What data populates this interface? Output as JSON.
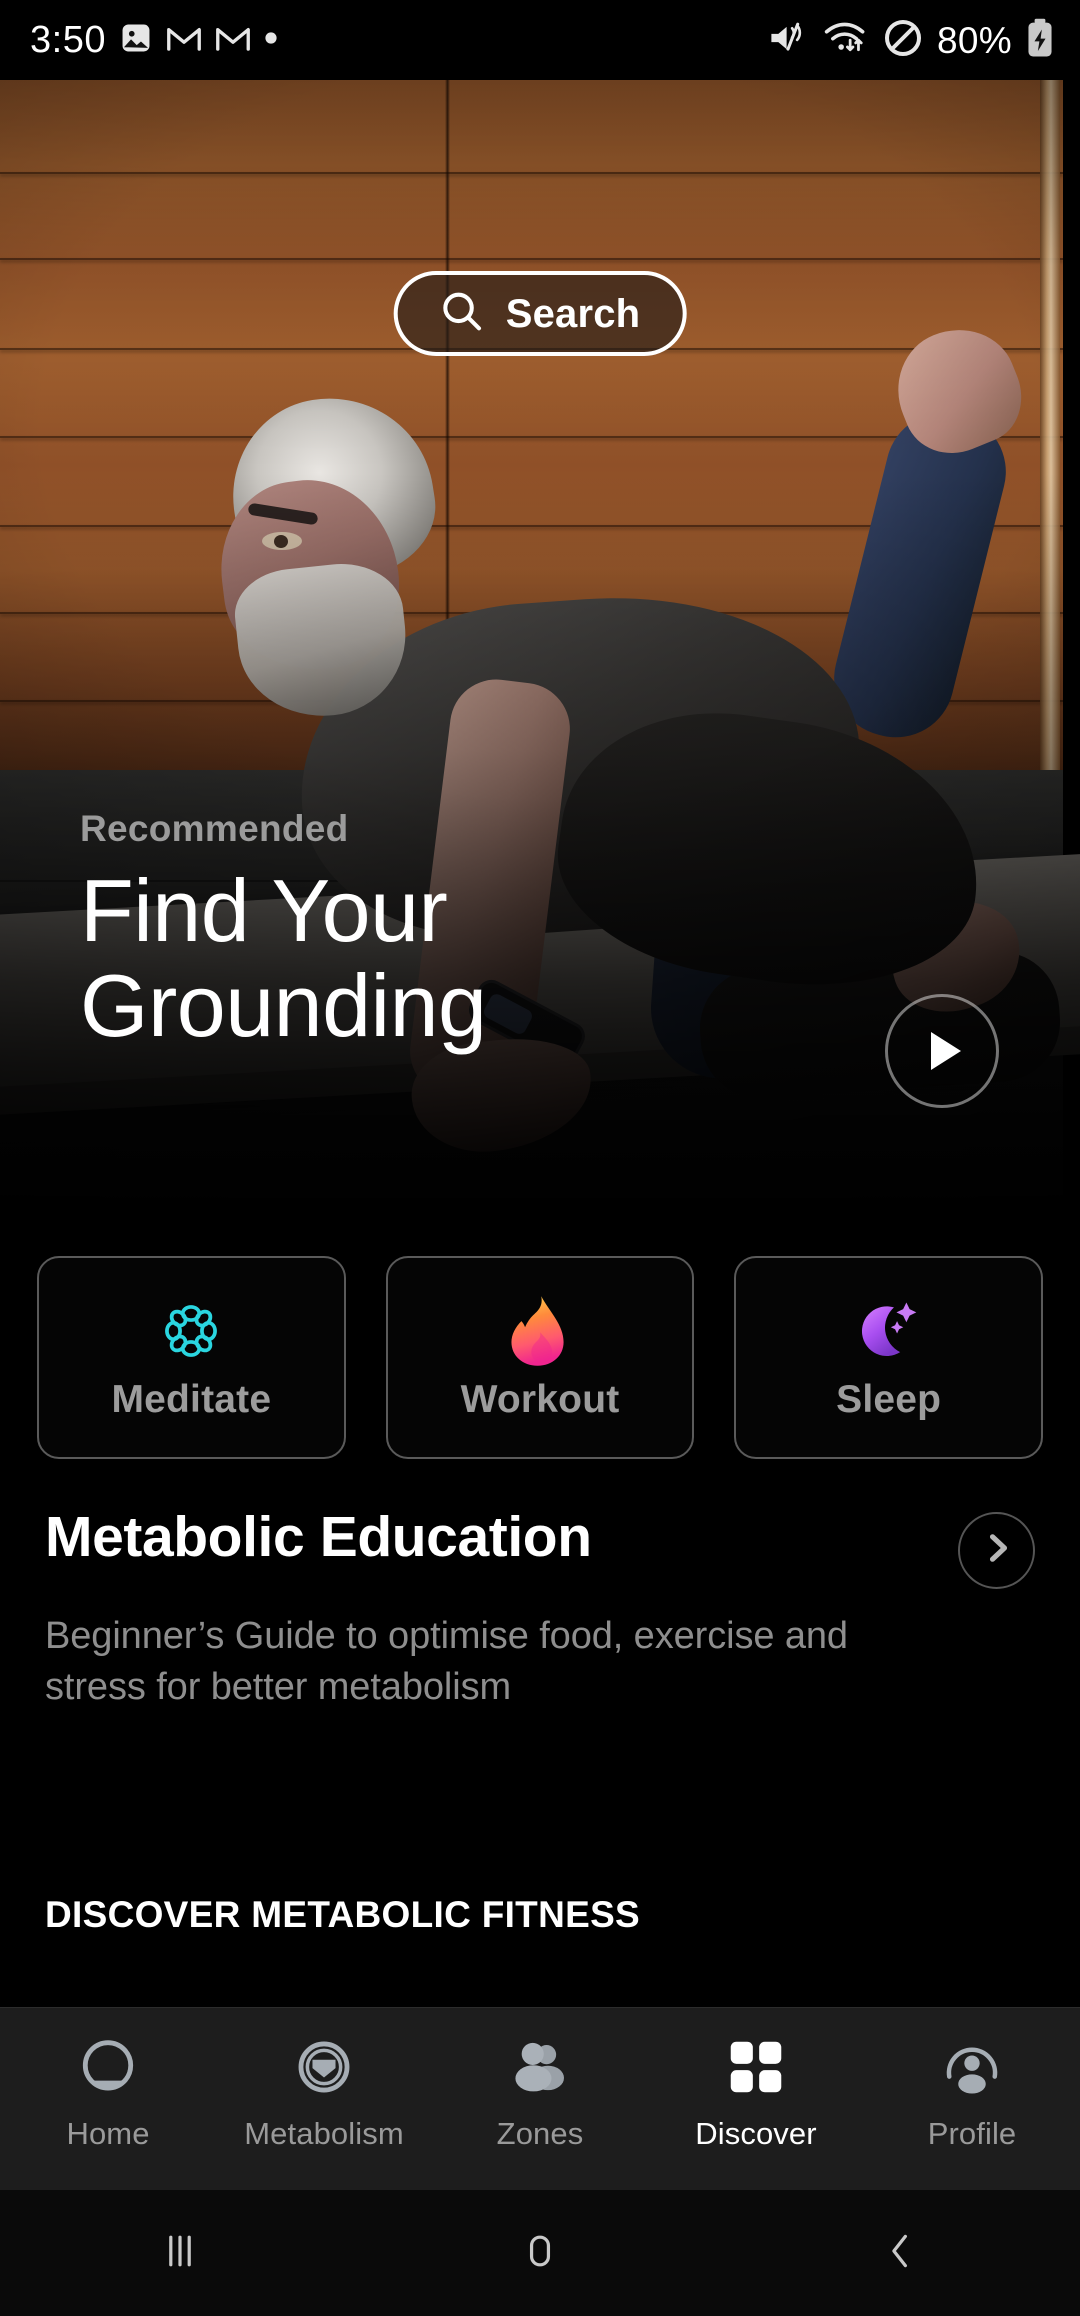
{
  "status_bar": {
    "time": "3:50",
    "left_icons": [
      "photo-icon",
      "gmail-icon",
      "gmail-icon",
      "dot-icon"
    ],
    "right_icons": [
      "mute-icon",
      "wifi-icon",
      "do-not-disturb-icon"
    ],
    "battery_percent": "80%",
    "battery_icon": "battery-charging-icon"
  },
  "hero": {
    "search_label": "Search",
    "search_icon": "search-icon",
    "kicker": "Recommended",
    "title_line1": "Find Your",
    "title_line2": "Grounding",
    "play_icon": "play-icon"
  },
  "categories": [
    {
      "label": "Meditate",
      "icon": "lotus-icon",
      "color": "#2ad6e0"
    },
    {
      "label": "Workout",
      "icon": "flame-icon",
      "color": "#ff7a3d"
    },
    {
      "label": "Sleep",
      "icon": "moon-icon",
      "color": "#b05cf0"
    }
  ],
  "education": {
    "title": "Metabolic Education",
    "subtitle": "Beginner’s Guide to optimise food, exercise and stress for better metabolism",
    "chevron_icon": "chevron-right-icon"
  },
  "discover": {
    "section_header": "DISCOVER METABOLIC FITNESS"
  },
  "bottom_nav": {
    "active": "Discover",
    "items": [
      {
        "label": "Home",
        "icon": "home-circle-icon"
      },
      {
        "label": "Metabolism",
        "icon": "metabolism-gauge-icon"
      },
      {
        "label": "Zones",
        "icon": "people-icon"
      },
      {
        "label": "Discover",
        "icon": "grid-icon"
      },
      {
        "label": "Profile",
        "icon": "person-circle-icon"
      }
    ]
  },
  "android_nav": {
    "items": [
      {
        "name": "recents",
        "icon": "recents-icon"
      },
      {
        "name": "home",
        "icon": "home-icon"
      },
      {
        "name": "back",
        "icon": "back-icon"
      }
    ]
  },
  "theme": {
    "background": "#000000",
    "nav_background": "#1d1d1d",
    "accent_text": "#ffffff",
    "muted_text": "#8e8e8e"
  }
}
